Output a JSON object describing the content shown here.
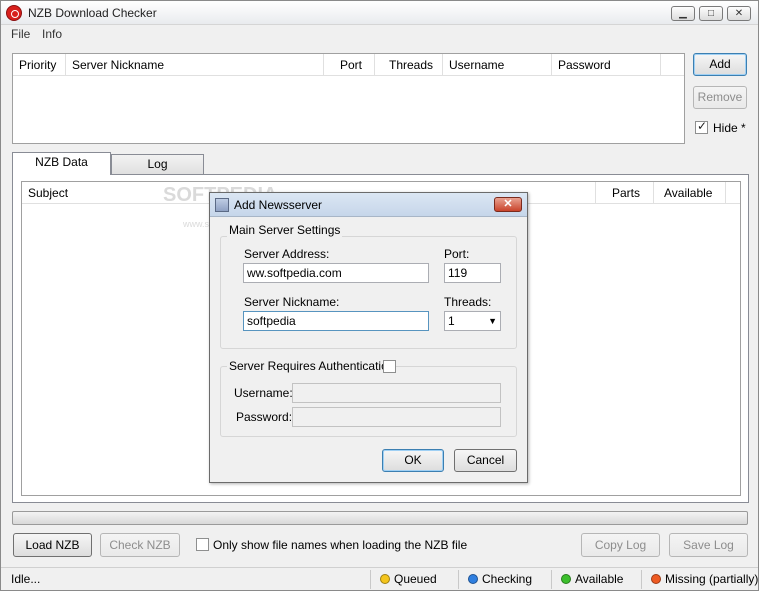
{
  "window": {
    "title": "NZB Download Checker"
  },
  "menu": [
    "File",
    "Info"
  ],
  "servers_table": {
    "columns": [
      "Priority",
      "Server Nickname",
      "Port",
      "Threads",
      "Username",
      "Password"
    ]
  },
  "side_buttons": {
    "add": "Add",
    "remove": "Remove",
    "hide_label": "Hide *",
    "hide_checked": true
  },
  "tabs": [
    "NZB Data",
    "Log"
  ],
  "nzb_table": {
    "columns": [
      "Subject",
      "Parts",
      "Available"
    ]
  },
  "watermark": {
    "big": "SOFTPEDIA",
    "small": "www.softpedia.com"
  },
  "bottom_bar": {
    "load": "Load NZB",
    "check": "Check NZB",
    "only_show_label": "Only show file names when loading the NZB file",
    "copy_log": "Copy Log",
    "save_log": "Save Log"
  },
  "status": {
    "text": "Idle...",
    "legend": [
      {
        "label": "Queued",
        "color": "#f4c51c"
      },
      {
        "label": "Checking",
        "color": "#2f7fe0"
      },
      {
        "label": "Available",
        "color": "#3cbf2c"
      },
      {
        "label": "Missing (partially)",
        "color": "#ee5a22"
      }
    ]
  },
  "dialog": {
    "title": "Add Newsserver",
    "main_group": "Main Server Settings",
    "server_address_label": "Server Address:",
    "server_address_value": "ww.softpedia.com",
    "port_label": "Port:",
    "port_value": "119",
    "nickname_label": "Server Nickname:",
    "nickname_value": "softpedia",
    "threads_label": "Threads:",
    "threads_value": "1",
    "auth_group": "Server Requires Authentication",
    "username_label": "Username:",
    "password_label": "Password:",
    "ok": "OK",
    "cancel": "Cancel"
  }
}
